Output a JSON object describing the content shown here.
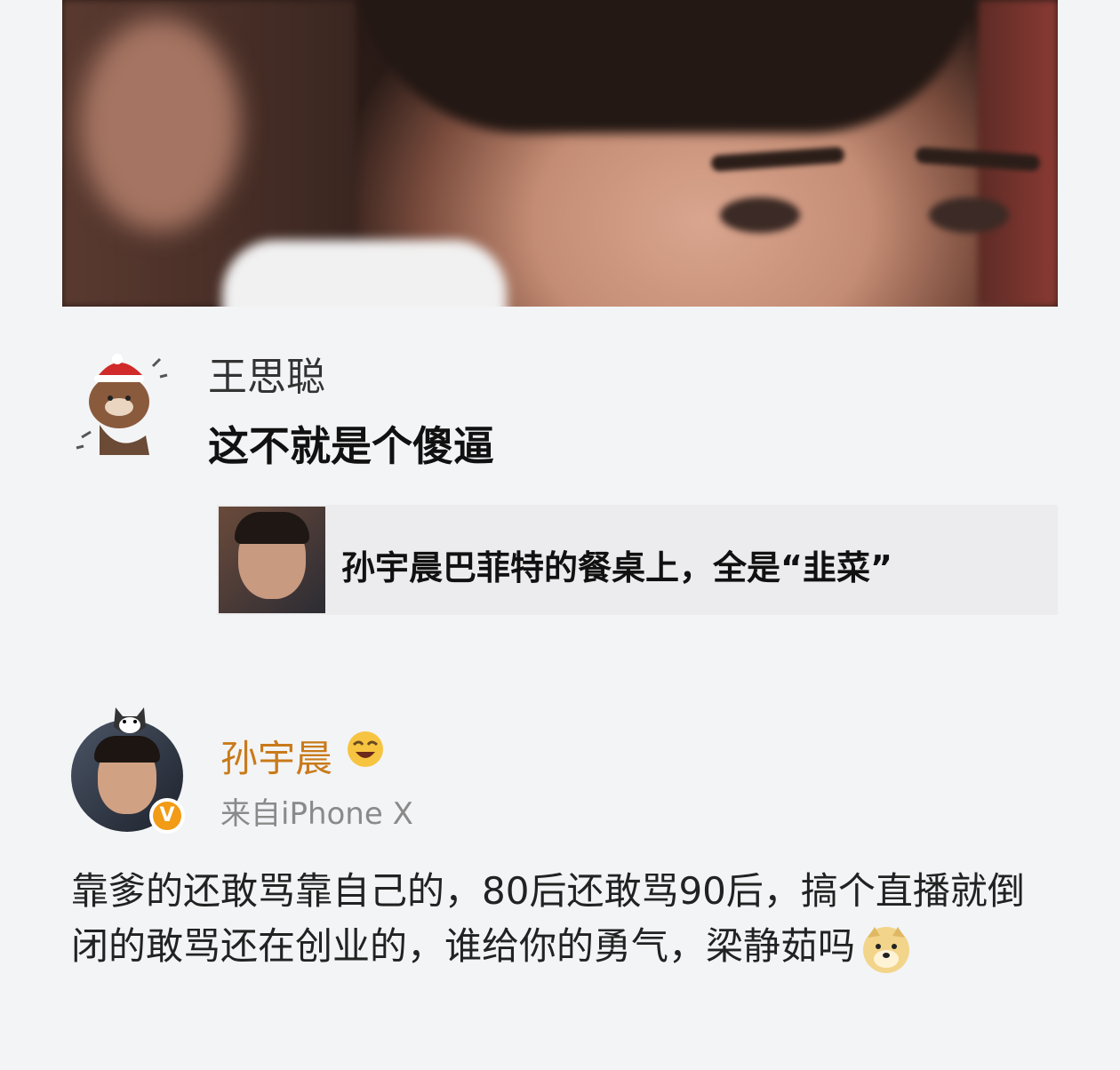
{
  "post": {
    "photo_icon": "person-photo",
    "comment": {
      "username": "王思聪",
      "text": "这不就是个傻逼",
      "avatar_icon": "bear-sticker-avatar"
    },
    "quoted_post": {
      "title": "孙宇晨巴菲特的餐桌上，全是“韭菜”",
      "thumb_icon": "person-thumbnail"
    },
    "reply": {
      "username": "孙宇晨",
      "source": "来自iPhone X",
      "verified_badge": "V",
      "text": "靠爹的还敢骂靠自己的，80后还敢骂90后，搞个直播就倒闭的敢骂还在创业的，谁给你的勇气，梁静茹吗",
      "emoji": "doge-emoji"
    }
  }
}
